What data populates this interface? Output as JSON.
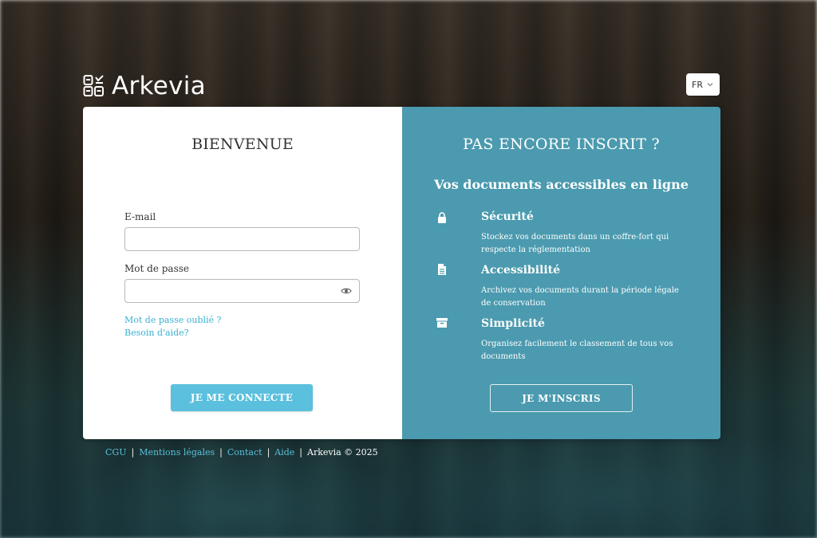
{
  "brand": {
    "name": "Arkevia"
  },
  "language": {
    "selected": "FR"
  },
  "login": {
    "title": "BIENVENUE",
    "email_label": "E-mail",
    "email_value": "",
    "password_label": "Mot de passe",
    "password_value": "",
    "forgot_link": "Mot de passe oublié ?",
    "help_link": "Besoin d'aide?",
    "submit_label": "JE ME CONNECTE"
  },
  "register": {
    "title": "PAS ENCORE INSCRIT ?",
    "subtitle": "Vos documents accessibles en ligne",
    "features": [
      {
        "icon": "lock-icon",
        "title": "Sécurité",
        "description": "Stockez vos documents dans un coffre-fort qui respecte la réglementation"
      },
      {
        "icon": "document-icon",
        "title": "Accessibilité",
        "description": "Archivez vos documents durant la période légale de conservation"
      },
      {
        "icon": "archive-box-icon",
        "title": "Simplicité",
        "description": "Organisez facilement le classement de tous vos documents"
      }
    ],
    "button_label": "JE M'INSCRIS"
  },
  "footer": {
    "links": [
      "CGU",
      "Mentions légales",
      "Contact",
      "Aide"
    ],
    "separator": "|",
    "copyright": "Arkevia © 2025"
  },
  "colors": {
    "accent": "#5bc0de",
    "panel": "#4b9aaf"
  }
}
